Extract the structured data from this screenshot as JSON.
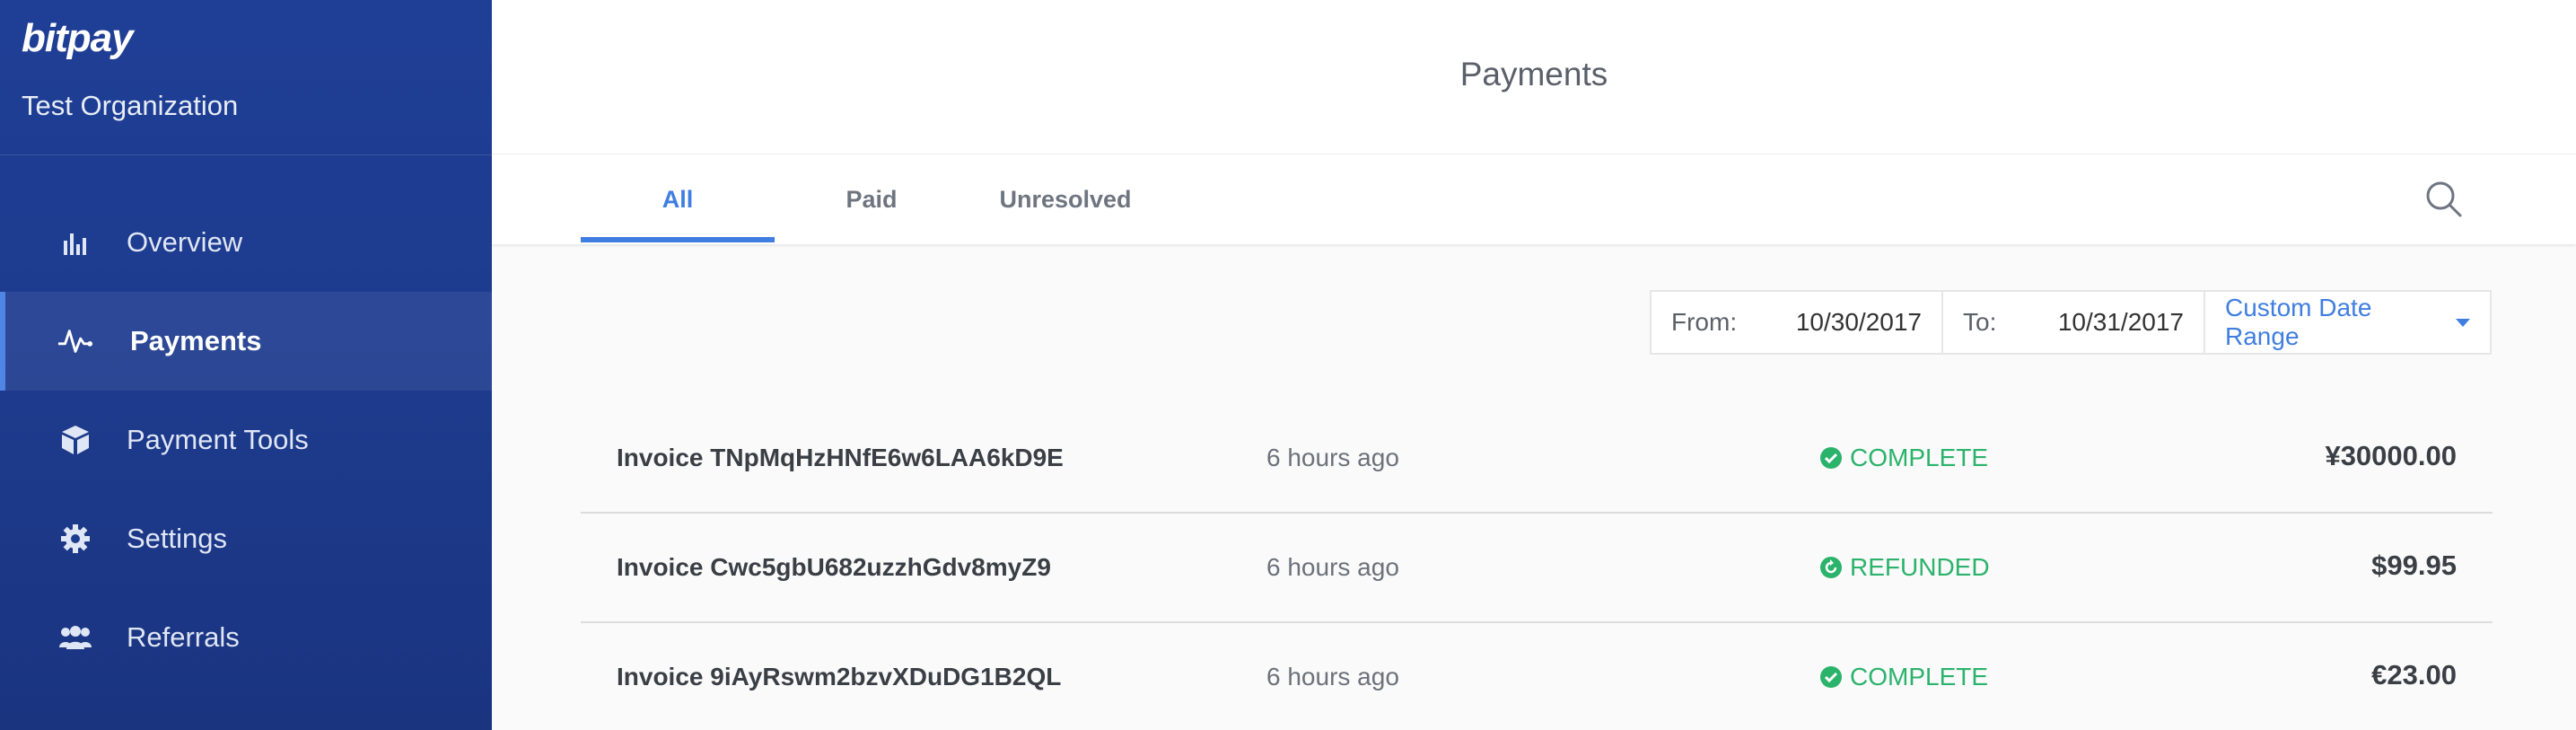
{
  "sidebar": {
    "brand": "bitpay",
    "organization": "Test Organization",
    "items": [
      {
        "label": "Overview",
        "icon": "bar-chart-icon",
        "active": false
      },
      {
        "label": "Payments",
        "icon": "pulse-icon",
        "active": true
      },
      {
        "label": "Payment Tools",
        "icon": "cube-icon",
        "active": false
      },
      {
        "label": "Settings",
        "icon": "gear-icon",
        "active": false
      },
      {
        "label": "Referrals",
        "icon": "users-icon",
        "active": false
      }
    ]
  },
  "header": {
    "title": "Payments"
  },
  "tabs": [
    {
      "label": "All",
      "active": true
    },
    {
      "label": "Paid",
      "active": false
    },
    {
      "label": "Unresolved",
      "active": false
    }
  ],
  "filter": {
    "from_label": "From:",
    "from_value": "10/30/2017",
    "to_label": "To:",
    "to_value": "10/31/2017",
    "range_label": "Custom Date Range"
  },
  "payments": [
    {
      "invoice": "Invoice TNpMqHzHNfE6w6LAA6kD9E",
      "time": "6 hours ago",
      "status": "COMPLETE",
      "status_icon": "check-circle-icon",
      "amount": "¥30000.00"
    },
    {
      "invoice": "Invoice Cwc5gbU682uzzhGdv8myZ9",
      "time": "6 hours ago",
      "status": "REFUNDED",
      "status_icon": "refund-circle-icon",
      "amount": "$99.95"
    },
    {
      "invoice": "Invoice 9iAyRswm2bzvXDuDG1B2QL",
      "time": "6 hours ago",
      "status": "COMPLETE",
      "status_icon": "check-circle-icon",
      "amount": "€23.00"
    }
  ],
  "colors": {
    "sidebar_bg": "#1f3f96",
    "accent": "#3f7ee0",
    "status_green": "#2bb36b"
  }
}
